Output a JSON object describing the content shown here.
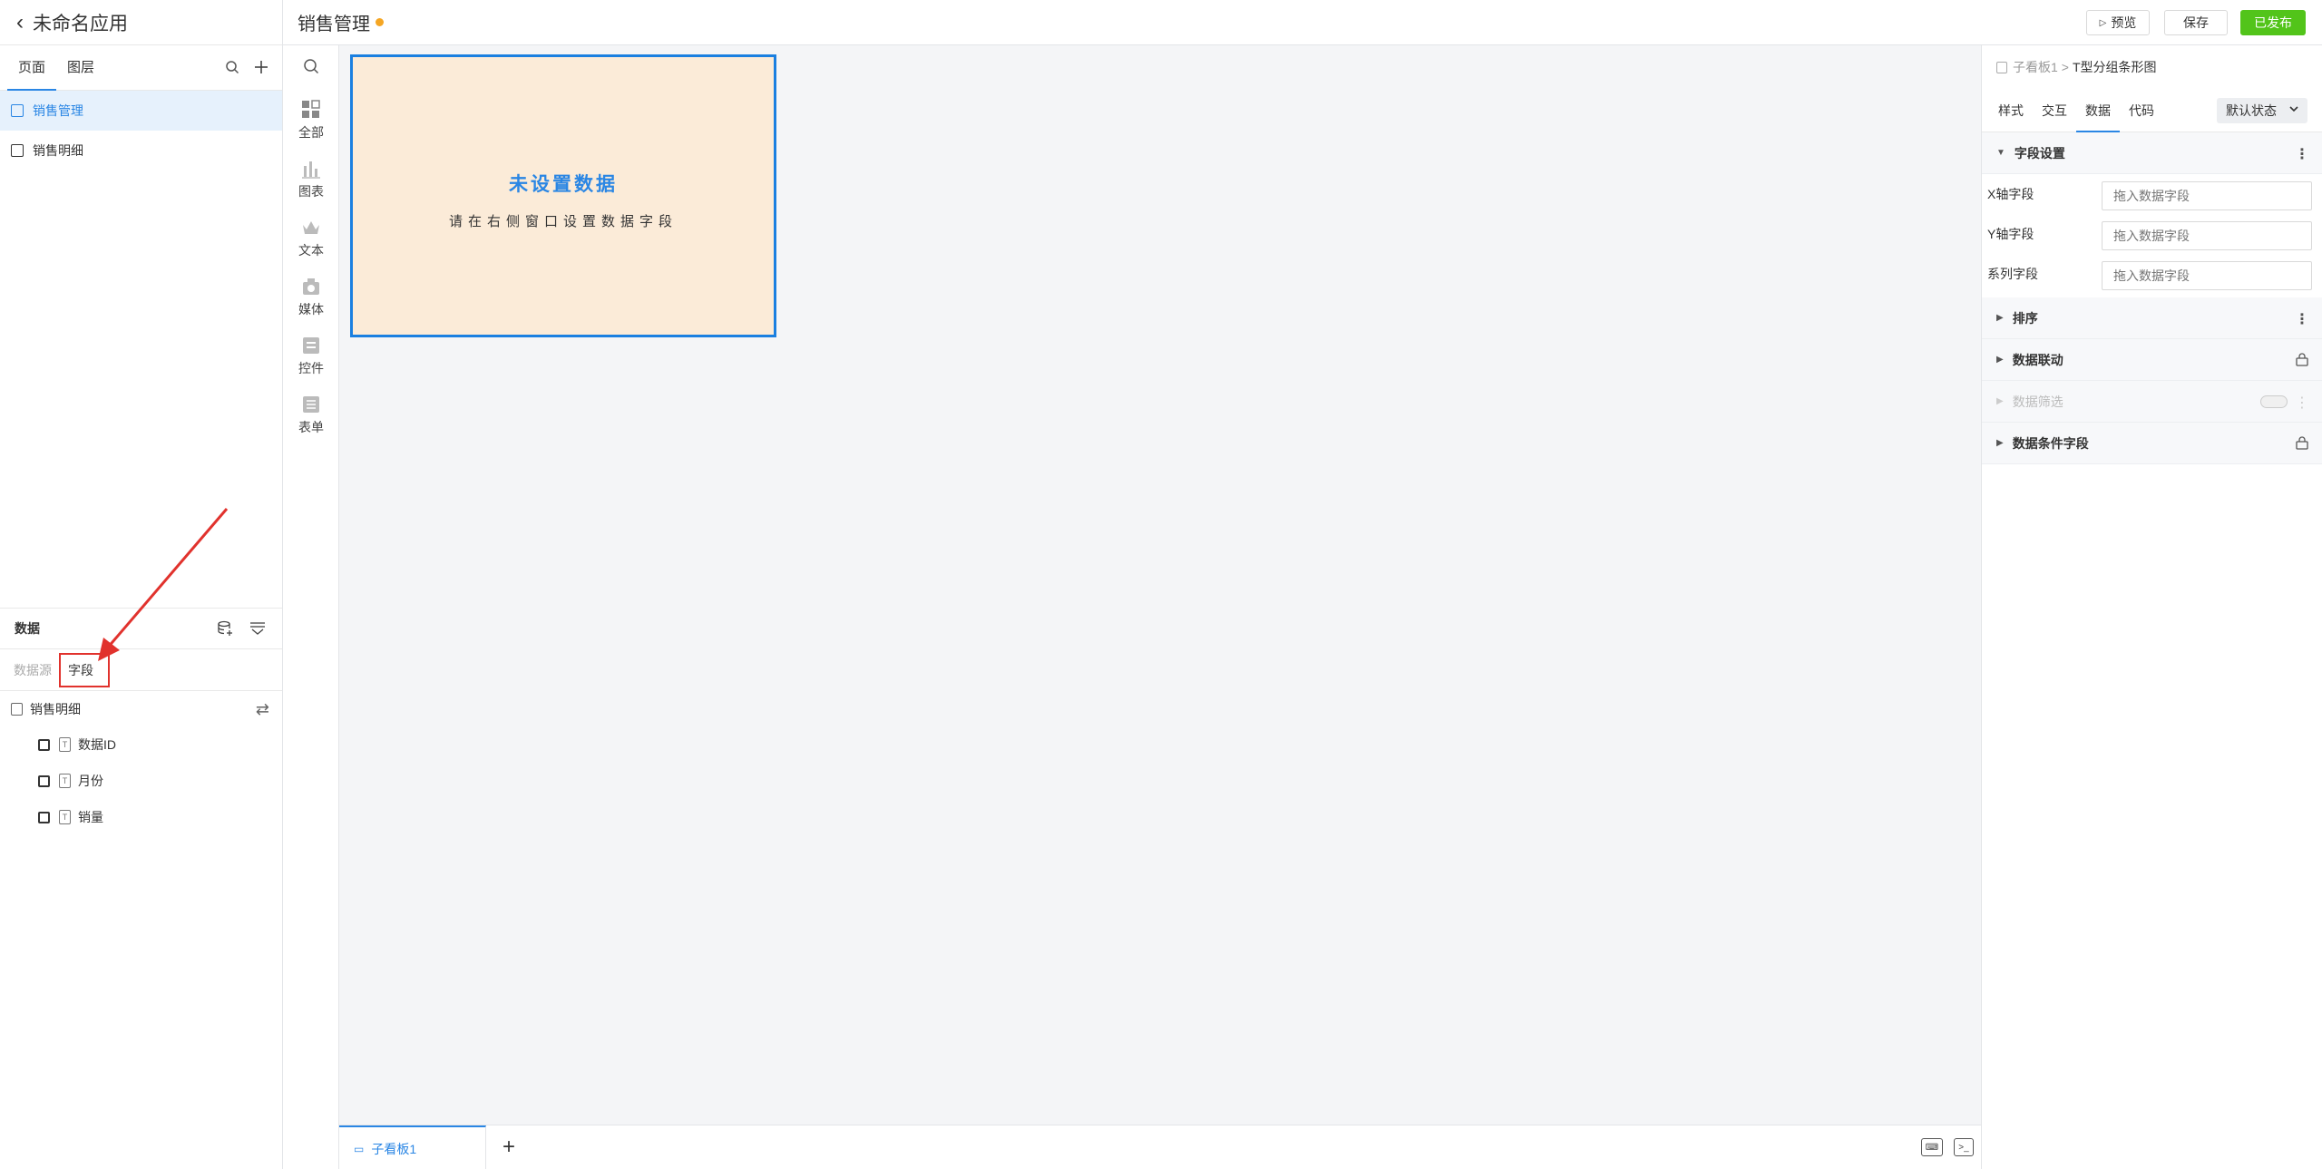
{
  "app": {
    "name": "未命名应用"
  },
  "left": {
    "tabs": [
      {
        "label": "页面"
      },
      {
        "label": "图层"
      }
    ],
    "pages": [
      {
        "label": "销售管理"
      },
      {
        "label": "销售明细"
      }
    ],
    "data_panel": {
      "title": "数据",
      "tabs": [
        {
          "label": "数据源"
        },
        {
          "label": "字段"
        }
      ],
      "source": "销售明细",
      "fields": [
        {
          "label": "数据ID",
          "type_icon": "text-field-icon"
        },
        {
          "label": "月份",
          "type_icon": "text-field-icon"
        },
        {
          "label": "销量",
          "type_icon": "text-field-icon"
        }
      ]
    }
  },
  "topbar": {
    "page_title": "销售管理",
    "preview": "预览",
    "save": "保存",
    "publish": "已发布"
  },
  "components": [
    {
      "label": "全部",
      "icon": "grid-icon"
    },
    {
      "label": "图表",
      "icon": "bar-chart-icon"
    },
    {
      "label": "文本",
      "icon": "text-icon"
    },
    {
      "label": "媒体",
      "icon": "media-icon"
    },
    {
      "label": "控件",
      "icon": "control-icon"
    },
    {
      "label": "表单",
      "icon": "form-icon"
    }
  ],
  "canvas": {
    "widget": {
      "title": "未设置数据",
      "subtitle": "请在右侧窗口设置数据字段"
    }
  },
  "bottombar": {
    "sheet_tab": "子看板1"
  },
  "right": {
    "breadcrumb": {
      "parent": "子看板1",
      "sep": ">",
      "current": "T型分组条形图"
    },
    "tabs": [
      {
        "label": "样式"
      },
      {
        "label": "交互"
      },
      {
        "label": "数据"
      },
      {
        "label": "代码"
      }
    ],
    "state": "默认状态",
    "sections": {
      "field_settings": "字段设置",
      "sort": "排序",
      "linkage": "数据联动",
      "filter": "数据筛选",
      "conditional": "数据条件字段"
    },
    "field_rows": [
      {
        "label": "X轴字段",
        "placeholder": "拖入数据字段"
      },
      {
        "label": "Y轴字段",
        "placeholder": "拖入数据字段"
      },
      {
        "label": "系列字段",
        "placeholder": "拖入数据字段"
      }
    ]
  },
  "colors": {
    "accent": "#2a86e4",
    "publish_green": "#52c41a",
    "highlight_red": "#e1322d",
    "widget_bg": "#fbebd8",
    "unsaved_dot": "#f5a623"
  }
}
